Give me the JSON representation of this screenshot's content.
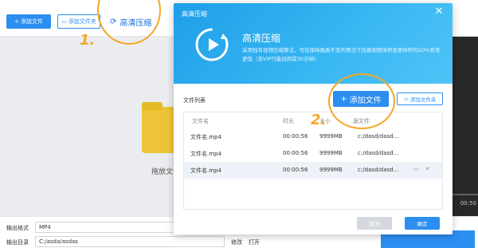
{
  "toolbar": {
    "add_file_label": "添加文件",
    "add_folder_label": "添加文件夹",
    "hd_compress_label": "高清压缩"
  },
  "steps": {
    "step1": "1.",
    "step2": "2."
  },
  "drop_area": {
    "hint": "拖放文件"
  },
  "player": {
    "timecode": "00:50"
  },
  "bottom": {
    "format_label": "输出格式",
    "format_value": "MP4",
    "dir_label": "输出目录",
    "dir_value": "C:/asda/asdas",
    "modify_label": "修改",
    "open_label": "打开"
  },
  "dialog": {
    "title": "高清压缩",
    "heading": "高清压缩",
    "description": "采用独有视频压缩算法，可在保持画质不变的情况下压缩视频体积至原体积的20%甚至更低（非VIP只能试用前30分钟）",
    "list_title": "文件列表",
    "add_file_label": "添加文件",
    "add_folder_label": "添加文件夹",
    "columns": [
      "文件名",
      "时长",
      "大小",
      "源文件"
    ],
    "rows": [
      {
        "name": "文件名.mp4",
        "duration": "00:00:56",
        "size": "9999MB",
        "source": "c:/dasd/dasd..."
      },
      {
        "name": "文件名.mp4",
        "duration": "00:00:56",
        "size": "9999MB",
        "source": "c:/dasd/dasd..."
      },
      {
        "name": "文件名.mp4",
        "duration": "00:00:56",
        "size": "9999MB",
        "source": "c:/dasd/dasd..."
      }
    ],
    "cancel_label": "取消",
    "ok_label": "确定"
  },
  "colors": {
    "accent": "#2b8ef0",
    "highlight": "#f5a623"
  }
}
